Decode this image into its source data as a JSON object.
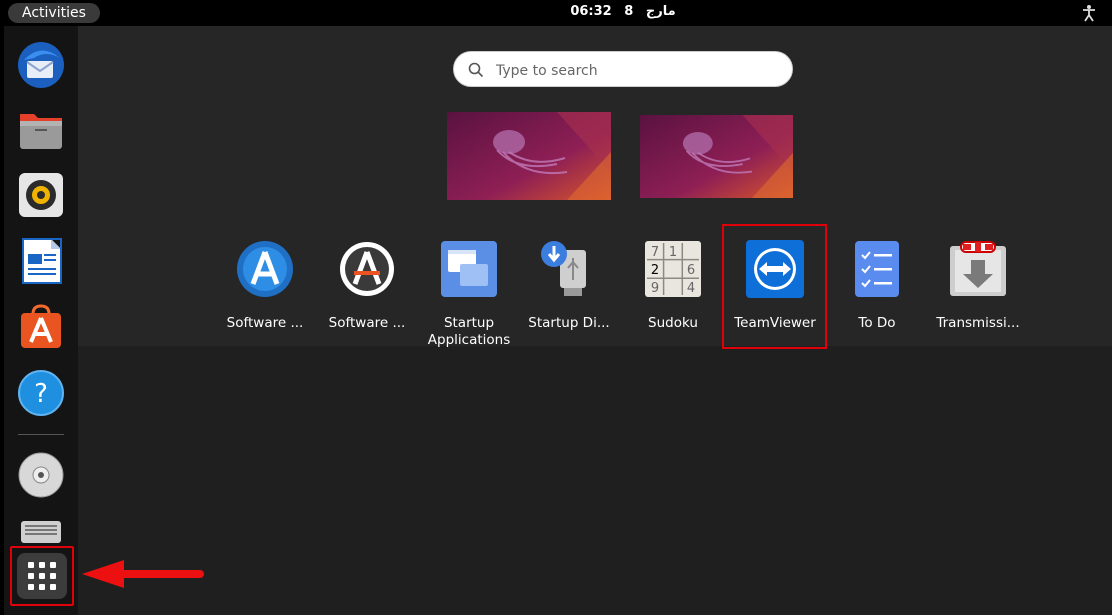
{
  "topbar": {
    "activities_label": "Activities",
    "time": "06:32",
    "date_day": "8",
    "date_month": "مارج",
    "system_icon": "accessibility-icon"
  },
  "search": {
    "placeholder": "Type to search",
    "value": ""
  },
  "dock": {
    "items": [
      {
        "name": "thunderbird",
        "icon": "mail-icon"
      },
      {
        "name": "files",
        "icon": "folder-icon"
      },
      {
        "name": "rhythmbox",
        "icon": "speaker-icon"
      },
      {
        "name": "writer",
        "icon": "document-icon"
      },
      {
        "name": "software",
        "icon": "store-icon"
      },
      {
        "name": "help",
        "icon": "help-icon"
      },
      {
        "name": "disc",
        "icon": "cd-icon"
      },
      {
        "name": "drive",
        "icon": "drive-icon"
      }
    ],
    "show_apps_icon": "grid-icon"
  },
  "apps": [
    {
      "label": "Software ...",
      "icon": "software-updater-icon"
    },
    {
      "label": "Software ...",
      "icon": "software-properties-icon"
    },
    {
      "label": "Startup Applications",
      "icon": "startup-apps-icon"
    },
    {
      "label": "Startup Di...",
      "icon": "usb-creator-icon"
    },
    {
      "label": "Sudoku",
      "icon": "sudoku-icon"
    },
    {
      "label": "TeamViewer",
      "icon": "teamviewer-icon"
    },
    {
      "label": "To Do",
      "icon": "todo-icon"
    },
    {
      "label": "Transmissi...",
      "icon": "transmission-icon"
    }
  ],
  "sudoku_digits": [
    "7",
    "1",
    "2",
    "6",
    "9",
    "4"
  ],
  "colors": {
    "highlight": "#e0000a",
    "accent": "#e95420",
    "teamviewer": "#0e6fd8"
  }
}
